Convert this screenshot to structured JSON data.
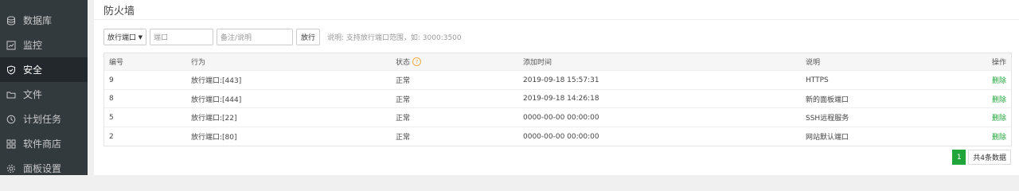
{
  "sidebar": {
    "items": [
      {
        "label": "数据库",
        "icon": "database-icon"
      },
      {
        "label": "监控",
        "icon": "monitor-icon"
      },
      {
        "label": "安全",
        "icon": "shield-icon",
        "active": true
      },
      {
        "label": "文件",
        "icon": "folder-icon"
      },
      {
        "label": "计划任务",
        "icon": "clock-icon"
      },
      {
        "label": "软件商店",
        "icon": "grid-icon"
      },
      {
        "label": "面板设置",
        "icon": "gear-icon"
      }
    ]
  },
  "page": {
    "title": "防火墙"
  },
  "toolbar": {
    "select_value": "放行端口",
    "port_placeholder": "端口",
    "note_placeholder": "备注/说明",
    "button_label": "放行",
    "hint": "说明: 支持放行端口范围，如: 3000:3500"
  },
  "table": {
    "headers": {
      "id": "编号",
      "action": "行为",
      "status": "状态",
      "time": "添加时间",
      "desc": "说明",
      "ops": "操作"
    },
    "rows": [
      {
        "id": "9",
        "action": "放行端口:[443]",
        "status": "正常",
        "time": "2019-09-18 15:57:31",
        "desc": "HTTPS",
        "op": "删除"
      },
      {
        "id": "8",
        "action": "放行端口:[444]",
        "status": "正常",
        "time": "2019-09-18 14:26:18",
        "desc": "新的面板端口",
        "op": "删除"
      },
      {
        "id": "5",
        "action": "放行端口:[22]",
        "status": "正常",
        "time": "0000-00-00 00:00:00",
        "desc": "SSH远程服务",
        "op": "删除"
      },
      {
        "id": "2",
        "action": "放行端口:[80]",
        "status": "正常",
        "time": "0000-00-00 00:00:00",
        "desc": "网站默认端口",
        "op": "删除"
      }
    ]
  },
  "pagination": {
    "current": "1",
    "total_text": "共4条数据"
  },
  "colors": {
    "accent": "#20a53a",
    "sidebar_bg": "#333a3e",
    "sidebar_active": "#22282b",
    "help_icon": "#f0ad4e"
  }
}
